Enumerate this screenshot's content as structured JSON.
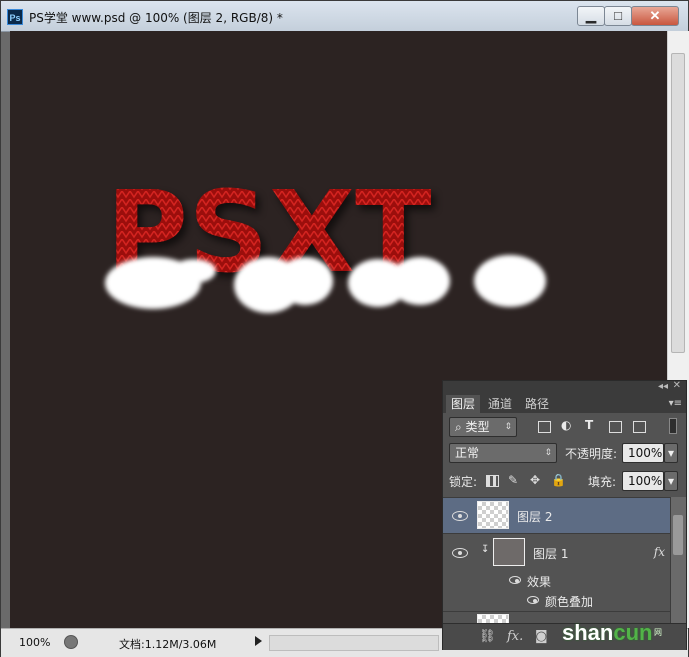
{
  "window": {
    "title": "PS学堂 www.psd @ 100% (图层 2, RGB/8) *",
    "minimize_glyph": "▁",
    "maximize_glyph": "□",
    "close_glyph": "✕"
  },
  "canvas": {
    "text": "PSXT",
    "background_color": "#2c2322",
    "text_color": "#b3120f",
    "fur_color": "#ffffff"
  },
  "status": {
    "zoom": "100%",
    "doc_info": "文档:1.12M/3.06M"
  },
  "layers_panel": {
    "tabs": [
      "图层",
      "通道",
      "路径"
    ],
    "filter_kind": "类型",
    "blend_mode": "正常",
    "opacity_label": "不透明度:",
    "opacity_value": "100%",
    "lock_label": "锁定:",
    "fill_label": "填充:",
    "fill_value": "100%",
    "layers": [
      {
        "name": "图层 2",
        "selected": true
      },
      {
        "name": "图层 1",
        "has_fx": true,
        "fx_label": "fx"
      }
    ],
    "effects_label": "效果",
    "effect_item": "颜色叠加",
    "bottom_fx": "fx."
  },
  "watermark": {
    "shan": "shan",
    "cun": "cun",
    "suffix": "网"
  }
}
